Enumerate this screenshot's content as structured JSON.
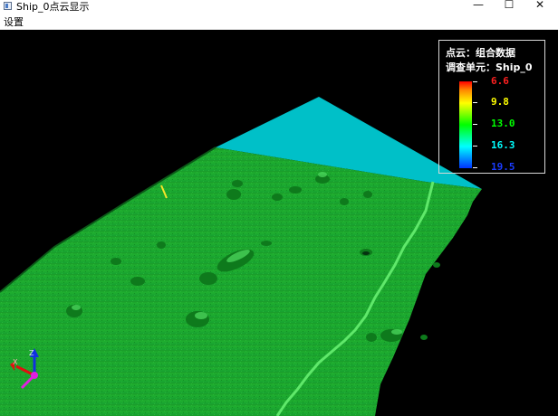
{
  "window": {
    "title": "Ship_0点云显示",
    "minimize_glyph": "—",
    "maximize_glyph": "☐",
    "close_glyph": "✕"
  },
  "menu": {
    "items": [
      {
        "label": "设置"
      }
    ]
  },
  "legend": {
    "title_line1": "点云：组合数据",
    "title_line2": "调查单元：Ship_0",
    "ticks": [
      {
        "label": "6.6",
        "color": "#ff2020"
      },
      {
        "label": "9.8",
        "color": "#ffff00"
      },
      {
        "label": "13.0",
        "color": "#00ff00"
      },
      {
        "label": "16.3",
        "color": "#00ffff"
      },
      {
        "label": "19.5",
        "color": "#1a3cff"
      }
    ]
  },
  "scene": {
    "terrain_color": "#1fae2f",
    "plane_color": "#00c0c8",
    "background": "#000000",
    "axes": {
      "x_color": "#e01010",
      "y_color": "#1030e0",
      "z_color": "#e020e0"
    }
  }
}
